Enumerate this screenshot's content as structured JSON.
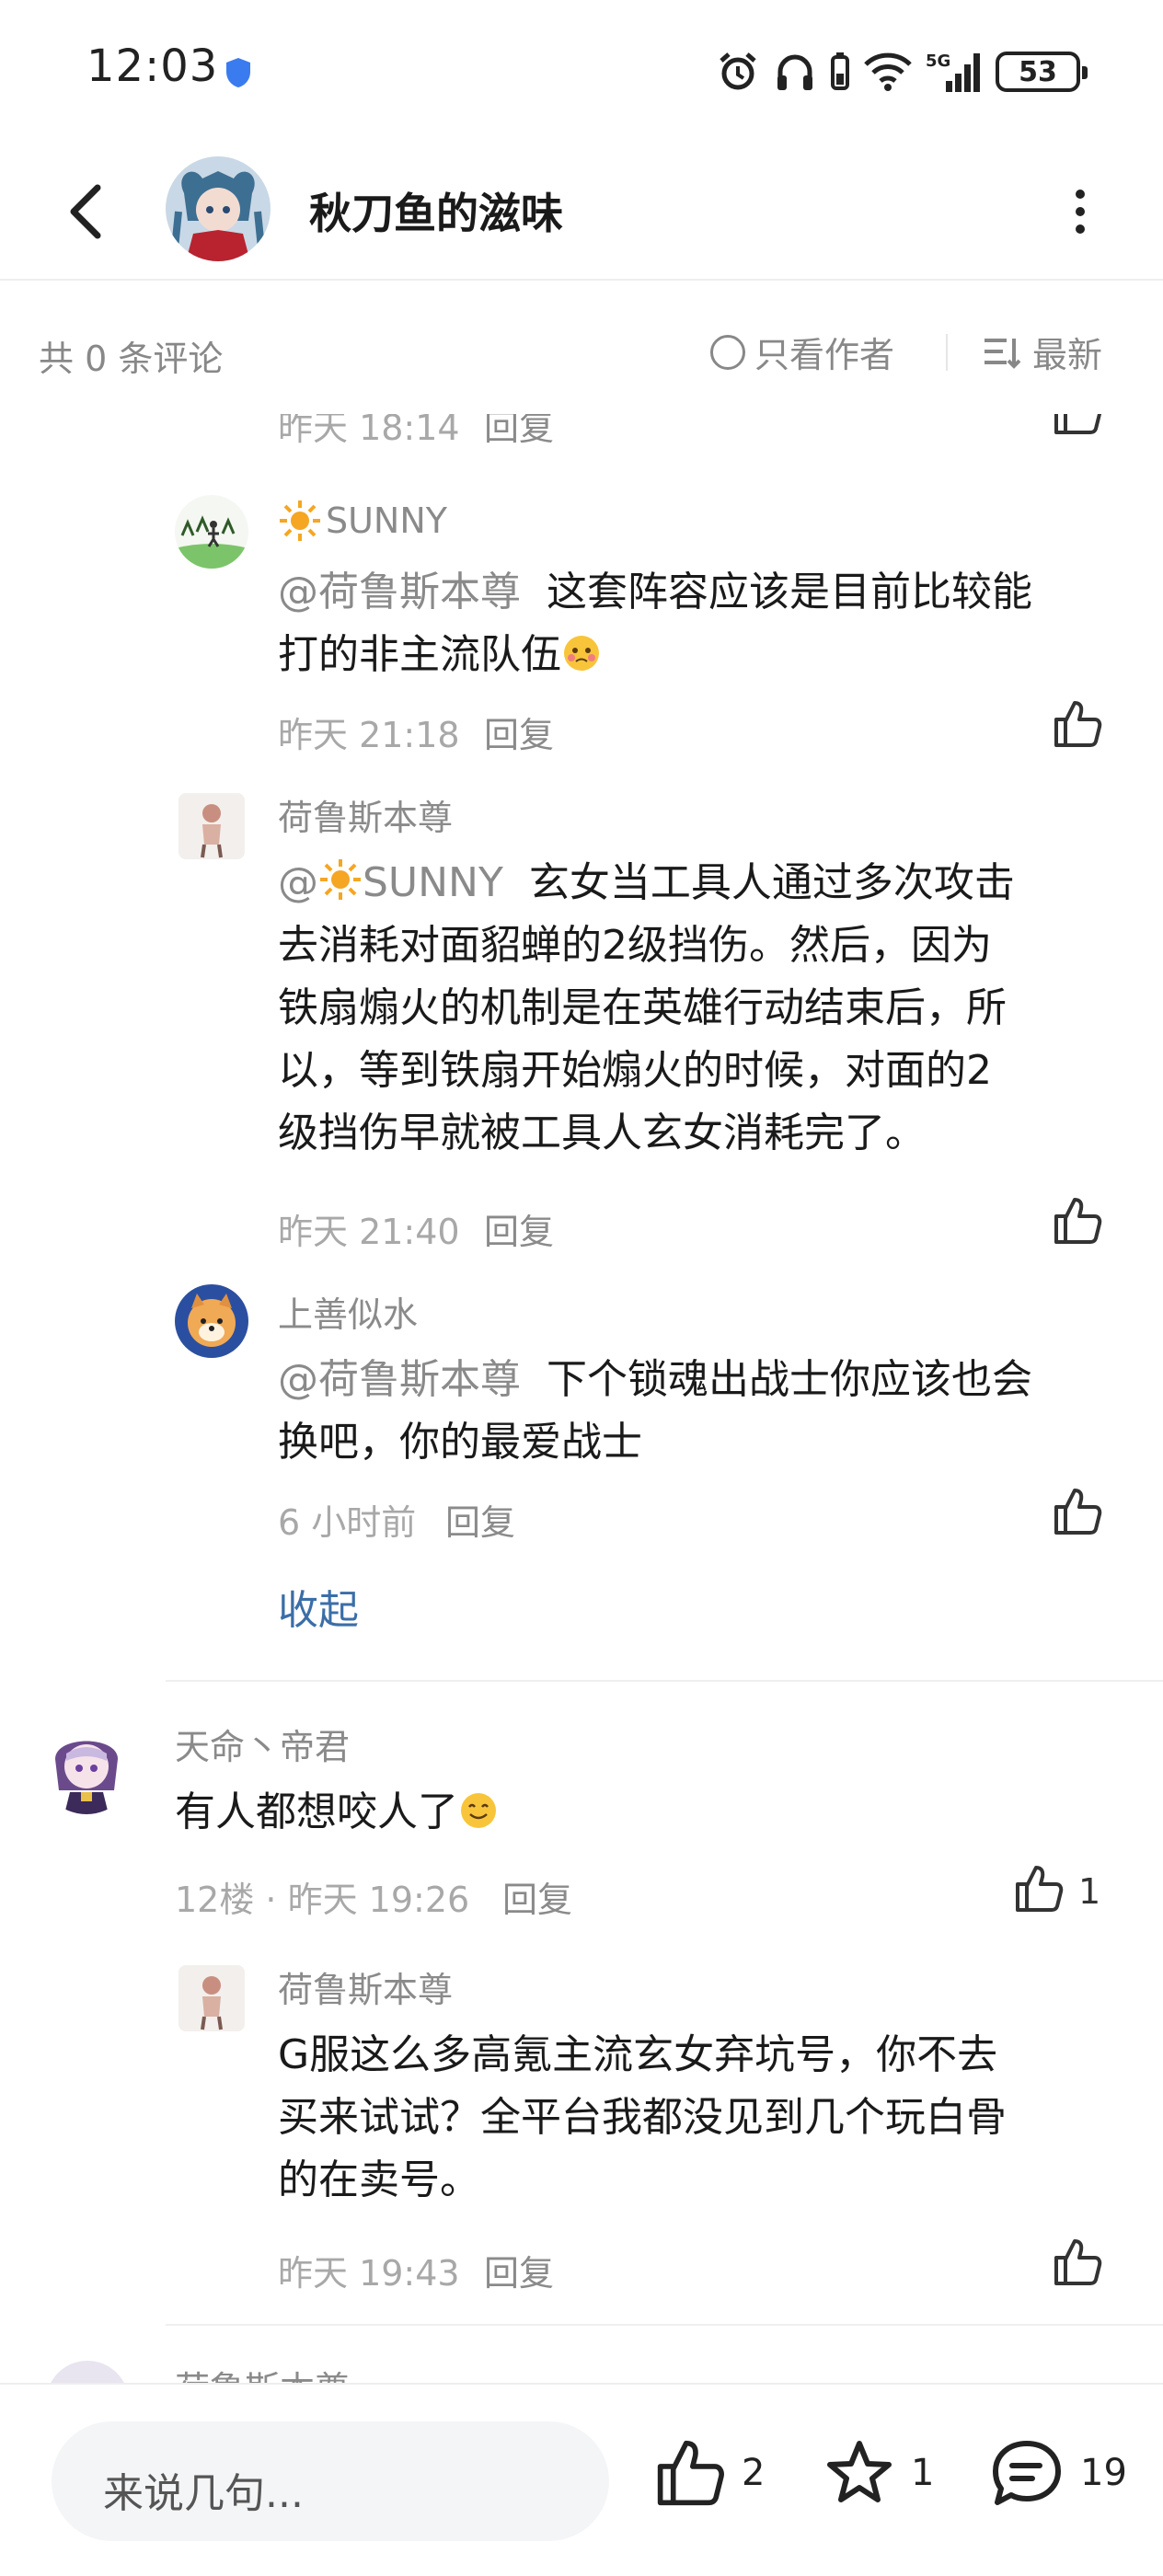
{
  "status_bar": {
    "time": "12:03",
    "battery": "53",
    "network": "5G"
  },
  "header": {
    "title": "秋刀鱼的滋味"
  },
  "filter_bar": {
    "comment_count": "共 0 条评论",
    "only_author": "只看作者",
    "sort": "最新"
  },
  "comments": {
    "partial_top": {
      "time": "昨天 18:14",
      "reply": "回复"
    },
    "reply1": {
      "name": "SUNNY",
      "mention": "@荷鲁斯本尊",
      "text_line1": "这套阵容应该是目前比较能",
      "text_line2": "打的非主流队伍",
      "time": "昨天 21:18",
      "reply": "回复"
    },
    "reply2": {
      "name": "荷鲁斯本尊",
      "mention_prefix": "@",
      "mention_name": "SUNNY",
      "text_line1": "玄女当工具人通过多次攻击",
      "text_line2": "去消耗对面貂蝉的2级挡伤。然后，因为",
      "text_line3": "铁扇煽火的机制是在英雄行动结束后，所",
      "text_line4": "以，等到铁扇开始煽火的时候，对面的2",
      "text_line5": "级挡伤早就被工具人玄女消耗完了。",
      "time": "昨天 21:40",
      "reply": "回复"
    },
    "reply3": {
      "name": "上善似水",
      "mention": "@荷鲁斯本尊",
      "text_line1": "下个锁魂出战士你应该也会",
      "text_line2": "换吧，你的最爱战士",
      "time": "6 小时前",
      "reply": "回复"
    },
    "collapse": "收起",
    "floor12": {
      "name": "天命丶帝君",
      "text": "有人都想咬人了",
      "meta": "12楼 · 昨天 19:26",
      "reply": "回复",
      "likes": "1"
    },
    "reply4": {
      "name": "荷鲁斯本尊",
      "text_line1": "G服这么多高氪主流玄女弃坑号，你不去",
      "text_line2": "买来试试？全平台我都没见到几个玩白骨",
      "text_line3": "的在卖号。",
      "time": "昨天 19:43",
      "reply": "回复"
    },
    "partial_bottom": {
      "name": "荷鲁斯本尊"
    }
  },
  "bottom_bar": {
    "input_placeholder": "来说几句...",
    "like_count": "2",
    "fav_count": "1",
    "comment_count": "19"
  },
  "colors": {
    "link_blue": "#3b6ea8",
    "secondary_text": "#8a8a8a"
  }
}
